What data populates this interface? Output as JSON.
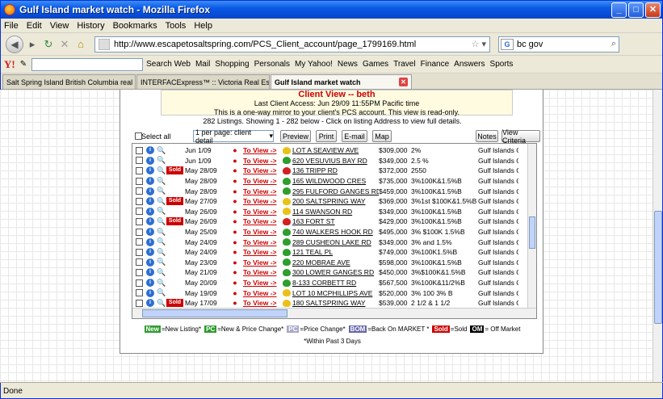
{
  "window": {
    "title": "Gulf Island market watch - Mozilla Firefox"
  },
  "menu": [
    "File",
    "Edit",
    "View",
    "History",
    "Bookmarks",
    "Tools",
    "Help"
  ],
  "nav": {
    "url": "http://www.escapetosaltspring.com/PCS_Client_account/page_1799169.html",
    "search_value": "bc gov"
  },
  "yahoo": {
    "items": [
      "Search Web",
      "Mail",
      "Shopping",
      "Personals",
      "My Yahoo!",
      "News",
      "Games",
      "Travel",
      "Finance",
      "Answers",
      "Sports"
    ]
  },
  "tabs": [
    {
      "label": "Salt Spring Island British Columbia real ..."
    },
    {
      "label": "INTERFACExpress™ :: Victoria Real Est..."
    },
    {
      "label": "Gulf Island market watch"
    }
  ],
  "client_view": {
    "heading": "Client View -- beth",
    "last_access": "Last Client Access: Jun 29/09 11:55PM Pacific time",
    "note": "This is a one-way mirror to your client's PCS account. This view is read-only."
  },
  "listing_count": "282 Listings. Showing 1 - 282 below - Click on listing Address to view full details.",
  "controls": {
    "select_all": "Select all",
    "per_page": "1 per page: client detail",
    "preview": "Preview",
    "print": "Print",
    "email": "E-mail",
    "map": "Map",
    "notes": "Notes",
    "view_criteria": "View Criteria"
  },
  "to_view_label": "To View ->",
  "sold_label": "Sold",
  "colors": {
    "new": "#2f9b2f",
    "pc_new": "#2f9b2f",
    "pc": "#a8a8c8",
    "bom": "#6666aa",
    "sold": "#cc0000",
    "om": "#000000",
    "green_icon": "#2e9e2e",
    "red_icon": "#d42020",
    "yellow_icon": "#e8c21a"
  },
  "rows": [
    {
      "sold": false,
      "date": "Jun 1/09",
      "icon": "yellow",
      "addr": "LOT A SEAVIEW AVE",
      "price": "$309,000",
      "comm": "2%",
      "area": "Gulf Islands GI"
    },
    {
      "sold": false,
      "date": "Jun 1/09",
      "icon": "green",
      "addr": "620 VESUVIUS BAY RD",
      "price": "$349,000",
      "comm": "2.5 %",
      "area": "Gulf Islands GI"
    },
    {
      "sold": true,
      "date": "May 28/09",
      "icon": "red",
      "addr": "136 TRIPP RD",
      "price": "$372,000",
      "comm": "2550",
      "area": "Gulf Islands GI"
    },
    {
      "sold": false,
      "date": "May 28/09",
      "icon": "green",
      "addr": "165 WILDWOOD CRES",
      "price": "$735,000",
      "comm": "3%100K&1.5%B",
      "area": "Gulf Islands GI"
    },
    {
      "sold": false,
      "date": "May 28/09",
      "icon": "green",
      "addr": "295 FULFORD GANGES RD",
      "price": "$459,000",
      "comm": "3%100K&1.5%B",
      "area": "Gulf Islands GI"
    },
    {
      "sold": true,
      "date": "May 27/09",
      "icon": "yellow",
      "addr": "200 SALTSPRING WAY",
      "price": "$369,000",
      "comm": "3%1st $100K&1.5%B",
      "area": "Gulf Islands GI"
    },
    {
      "sold": false,
      "date": "May 26/09",
      "icon": "yellow",
      "addr": "114 SWANSON RD",
      "price": "$349,000",
      "comm": "3%100K&1.5%B",
      "area": "Gulf Islands GI"
    },
    {
      "sold": true,
      "date": "May 26/09",
      "icon": "red",
      "addr": "163 FORT ST",
      "price": "$429,000",
      "comm": "3%100K&1.5%B",
      "area": "Gulf Islands GI"
    },
    {
      "sold": false,
      "date": "May 25/09",
      "icon": "green",
      "addr": "740 WALKERS HOOK RD",
      "price": "$495,000",
      "comm": "3% $100K 1.5%B",
      "area": "Gulf Islands GI"
    },
    {
      "sold": false,
      "date": "May 24/09",
      "icon": "green",
      "addr": "289 CUSHEON LAKE RD",
      "price": "$349,000",
      "comm": "3% and 1.5%",
      "area": "Gulf Islands GI"
    },
    {
      "sold": false,
      "date": "May 24/09",
      "icon": "green",
      "addr": "121 TEAL PL",
      "price": "$749,000",
      "comm": "3%100K1.5%B",
      "area": "Gulf Islands GI"
    },
    {
      "sold": false,
      "date": "May 23/09",
      "icon": "green",
      "addr": "220 MOBRAE AVE",
      "price": "$598,000",
      "comm": "3%100K&1.5%B",
      "area": "Gulf Islands GI"
    },
    {
      "sold": false,
      "date": "May 21/09",
      "icon": "green",
      "addr": "300 LOWER GANGES RD",
      "price": "$450,000",
      "comm": "3%$100K&1.5%B",
      "area": "Gulf Islands GI"
    },
    {
      "sold": false,
      "date": "May 20/09",
      "icon": "green",
      "addr": "8-133 CORBETT RD",
      "price": "$567,500",
      "comm": "3%100K&11/2%B",
      "area": "Gulf Islands GI"
    },
    {
      "sold": false,
      "date": "May 19/09",
      "icon": "yellow",
      "addr": "LOT 10 MCPHILLIPS AVE",
      "price": "$520,000",
      "comm": "3% 100 3% B",
      "area": "Gulf Islands GI"
    },
    {
      "sold": true,
      "date": "May 17/09",
      "icon": "yellow",
      "addr": "180 SALTSPRING WAY",
      "price": "$539,000",
      "comm": "2 1/2 & 1 1/2",
      "area": "Gulf Islands GI"
    }
  ],
  "legend": {
    "new": "New",
    "new_text": "=New Listing*",
    "pc": "PC",
    "pc_text": "=New & Price Change*",
    "pc2": "PC",
    "pc2_text": "=Price Change*",
    "bom": "BOM",
    "bom_text": "=Back On MARKET *",
    "sold": "Sold",
    "sold_text": "=Sold",
    "om": "OM",
    "om_text": "= Off Market",
    "footnote": "*Within Past 3 Days"
  },
  "status": "Done"
}
